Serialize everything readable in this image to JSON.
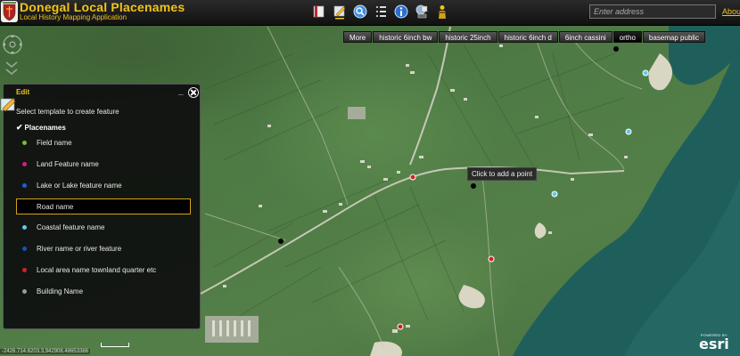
{
  "header": {
    "title": "Donegal Local Placenames",
    "subtitle": "Local History Mapping Application",
    "address_placeholder": "Enter address",
    "about_label": "Abou"
  },
  "toolbar": {
    "icons": [
      "bookmark-icon",
      "edit-icon",
      "search-icon",
      "list-icon",
      "info-icon",
      "print-icon",
      "person-icon"
    ]
  },
  "basemaps": [
    "More",
    "historic 6inch bw",
    "historic 25inch",
    "historic 6inch d",
    "6inch cassini",
    "ortho",
    "basemap public"
  ],
  "basemap_active": "ortho",
  "edit_panel": {
    "title": "Edit",
    "instruction": "Select template to create feature",
    "group": "Placenames",
    "templates": [
      {
        "label": "Field name",
        "color": "#6fbf3a"
      },
      {
        "label": "Land Feature name",
        "color": "#d81b8c"
      },
      {
        "label": "Lake or Lake feature name",
        "color": "#1f5fd8"
      },
      {
        "label": "Road name",
        "color": "#000000",
        "selected": true
      },
      {
        "label": "Coastal feature name",
        "color": "#5ec8f0"
      },
      {
        "label": "River name or river feature",
        "color": "#1c4fc0"
      },
      {
        "label": "Local area name townland quarter etc",
        "color": "#d42020"
      },
      {
        "label": "Building Name",
        "color": "#9a9a9a"
      }
    ]
  },
  "map": {
    "tooltip": "Click to add a point",
    "coordinates": "-2426.714.6203.3,942908.48653386",
    "attribution": {
      "powered": "POWERED BY",
      "brand": "esri"
    },
    "points": [
      {
        "type": "Local area name townland quarter etc",
        "color": "#d42020"
      },
      {
        "type": "Local area name townland quarter etc",
        "color": "#d42020"
      },
      {
        "type": "Local area name townland quarter etc",
        "color": "#d42020"
      },
      {
        "type": "Coastal feature name",
        "color": "#5ec8f0"
      },
      {
        "type": "Coastal feature name",
        "color": "#5ec8f0"
      },
      {
        "type": "Coastal feature name",
        "color": "#5ec8f0"
      },
      {
        "type": "Road name",
        "color": "#000000"
      },
      {
        "type": "Road name",
        "color": "#000000"
      },
      {
        "type": "Road name",
        "color": "#000000"
      }
    ]
  }
}
